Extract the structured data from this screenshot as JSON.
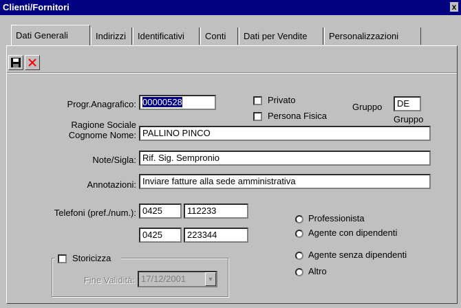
{
  "window": {
    "title": "Clienti/Fornitori",
    "close_label": "x"
  },
  "tabs": [
    "Dati Generali",
    "Indirizzi",
    "Identificativi",
    "Conti",
    "Dati per Vendite",
    "Personalizzazioni"
  ],
  "toolbar": {
    "save_icon": "floppy-disk-icon",
    "delete_icon": "red-x-icon",
    "accent": "#ff0000"
  },
  "form": {
    "progr_label": "Progr.Anagrafico:",
    "progr_value": "00000528",
    "privato_label": "Privato",
    "persona_fisica_label": "Persona Fisica",
    "gruppo_label": "Gruppo",
    "gruppo_value": "DE",
    "gruppo_caption": "Gruppo",
    "ragione_label_1": "Ragione Sociale",
    "ragione_label_2": "Cognome Nome:",
    "ragione_value": "PALLINO PINCO",
    "note_label": "Note/Sigla:",
    "note_value": "Rif. Sig. Sempronio",
    "annotazioni_label": "Annotazioni:",
    "annotazioni_value": "Inviare fatture alla sede amministrativa",
    "telefoni_label": "Telefoni (pref./num.):",
    "tel1_pref": "0425",
    "tel1_num": "112233",
    "tel2_pref": "0425",
    "tel2_num": "223344",
    "radio_options": [
      "Professionista",
      "Agente con dipendenti",
      "Agente senza dipendenti",
      "Altro"
    ],
    "storicizza_label": "Storicizza",
    "fine_validita_label": "Fine Validità:",
    "fine_validita_value": "17/12/2001"
  }
}
